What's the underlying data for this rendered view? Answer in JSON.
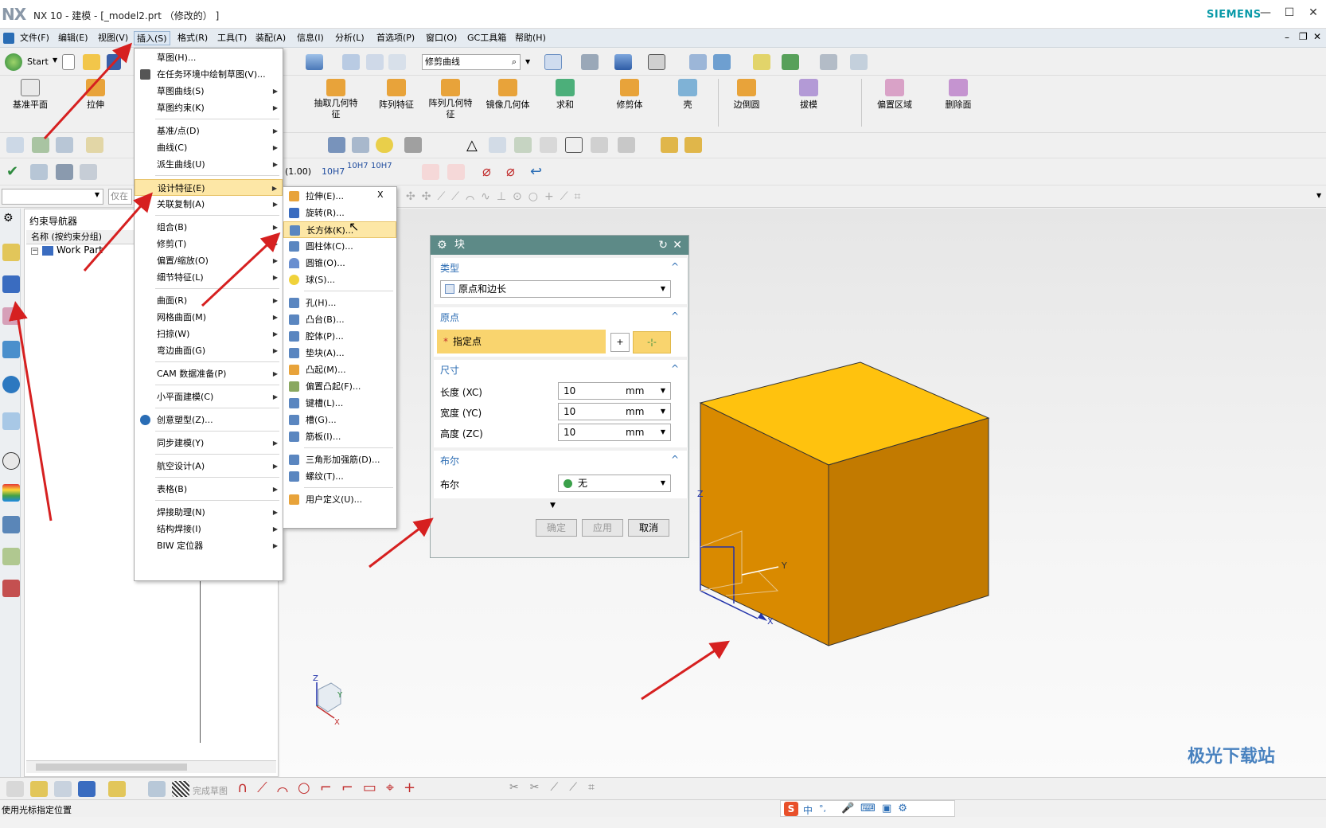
{
  "window": {
    "logo": "NX",
    "title": "NX 10 - 建模 - [_model2.prt （修改的） ]",
    "brand": "SIEMENS"
  },
  "menubar": [
    "文件(F)",
    "编辑(E)",
    "视图(V)",
    "插入(S)",
    "格式(R)",
    "工具(T)",
    "装配(A)",
    "信息(I)",
    "分析(L)",
    "首选项(P)",
    "窗口(O)",
    "GC工具箱",
    "帮助(H)"
  ],
  "toolbar": {
    "start": "Start",
    "curve_filter": "修剪曲线"
  },
  "ribbon": {
    "left": [
      "基准平面",
      "拉伸"
    ],
    "right": [
      "抽取几何特征",
      "阵列特征",
      "阵列几何特征",
      "镜像几何体",
      "求和",
      "修剪体",
      "壳",
      "边倒圆",
      "拔模",
      "偏置区域",
      "删除面"
    ]
  },
  "toolbar_row4": [
    "10H7",
    "(1.00)",
    "10H7"
  ],
  "selection_bar": {
    "filter_placeholder": "仅在"
  },
  "navigator": {
    "title": "约束导航器",
    "column": "名称 (按约束分组)",
    "root": "Work Part"
  },
  "insert_menu": {
    "items": [
      {
        "label": "草图(H)...",
        "submenu": false
      },
      {
        "label": "在任务环境中绘制草图(V)...",
        "submenu": false
      },
      {
        "label": "草图曲线(S)",
        "submenu": true
      },
      {
        "label": "草图约束(K)",
        "submenu": true
      },
      {
        "label": "基准/点(D)",
        "submenu": true
      },
      {
        "label": "曲线(C)",
        "submenu": true
      },
      {
        "label": "派生曲线(U)",
        "submenu": true
      },
      {
        "label": "设计特征(E)",
        "submenu": true
      },
      {
        "label": "关联复制(A)",
        "submenu": true
      },
      {
        "label": "组合(B)",
        "submenu": true
      },
      {
        "label": "修剪(T)",
        "submenu": true
      },
      {
        "label": "偏置/缩放(O)",
        "submenu": true
      },
      {
        "label": "细节特征(L)",
        "submenu": true
      },
      {
        "label": "曲面(R)",
        "submenu": true
      },
      {
        "label": "网格曲面(M)",
        "submenu": true
      },
      {
        "label": "扫掠(W)",
        "submenu": true
      },
      {
        "label": "弯边曲面(G)",
        "submenu": true
      },
      {
        "label": "CAM 数据准备(P)",
        "submenu": true
      },
      {
        "label": "小平面建模(C)",
        "submenu": true
      },
      {
        "label": "创意塑型(Z)...",
        "submenu": false
      },
      {
        "label": "同步建模(Y)",
        "submenu": true
      },
      {
        "label": "航空设计(A)",
        "submenu": true
      },
      {
        "label": "表格(B)",
        "submenu": true
      },
      {
        "label": "焊接助理(N)",
        "submenu": true
      },
      {
        "label": "结构焊接(I)",
        "submenu": true
      },
      {
        "label": "BIW 定位器",
        "submenu": true
      }
    ]
  },
  "design_feature_menu": {
    "close": "X",
    "items": [
      "拉伸(E)...",
      "旋转(R)...",
      "长方体(K)...",
      "圆柱体(C)...",
      "圆锥(O)...",
      "球(S)...",
      "孔(H)...",
      "凸台(B)...",
      "腔体(P)...",
      "垫块(A)...",
      "凸起(M)...",
      "偏置凸起(F)...",
      "键槽(L)...",
      "槽(G)...",
      "筋板(I)...",
      "三角形加强筋(D)...",
      "螺纹(T)...",
      "用户定义(U)..."
    ]
  },
  "block_dialog": {
    "title": "块",
    "type_section": "类型",
    "type_value": "原点和边长",
    "origin_section": "原点",
    "specify_point": "指定点",
    "required_mark": "*",
    "size_section": "尺寸",
    "length_label": "长度 (XC)",
    "width_label": "宽度 (YC)",
    "height_label": "高度 (ZC)",
    "length_value": "10",
    "width_value": "10",
    "height_value": "10",
    "unit": "mm",
    "boolean_section": "布尔",
    "boolean_label": "布尔",
    "boolean_value": "无",
    "ok": "确定",
    "apply": "应用",
    "cancel": "取消"
  },
  "csys": {
    "x": "X",
    "y": "Y",
    "z": "Z"
  },
  "bottom_toolbar": {
    "finish_sketch": "完成草图"
  },
  "status": "使用光标指定位置",
  "ime": [
    "中",
    "°,"
  ],
  "watermark": "极光下载站",
  "colors": {
    "accent": "#0a9aa8",
    "dialog_header": "#5d8a87",
    "section_title": "#2b6cb3",
    "menu_highlight": "#fde7a6",
    "cube_top": "#ffc20e",
    "cube_front": "#d98a00",
    "cube_side": "#c27a00",
    "arrow": "#d62020"
  }
}
